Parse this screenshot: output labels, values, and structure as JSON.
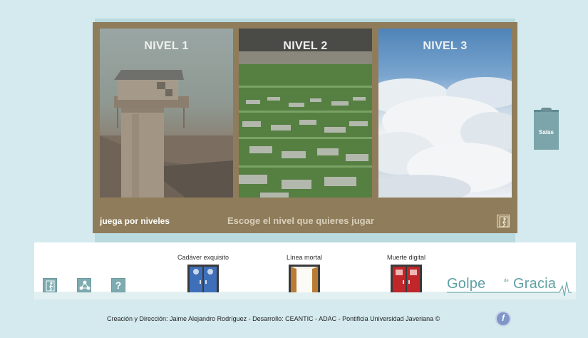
{
  "levels": [
    {
      "label": "NIVEL 1",
      "scene": "wooden-watchtower"
    },
    {
      "label": "NIVEL 2",
      "scene": "grassy-cemetery"
    },
    {
      "label": "NIVEL 3",
      "scene": "clouds-sky"
    }
  ],
  "frame": {
    "subtitle": "juega por niveles",
    "instruction": "Escoge el nivel que quieres jugar",
    "exit_icon": "exit-person-icon"
  },
  "side_tab": {
    "label": "Salas",
    "icon": "clipboard-clip-icon"
  },
  "toolbar": {
    "exit_icon": "exit-person-icon",
    "network_icon": "network-nodes-icon",
    "help_label": "?"
  },
  "doors": [
    {
      "title": "Cadáver exquisito",
      "state": "closed",
      "color": "#3f6fb8"
    },
    {
      "title": "Línea mortal",
      "state": "open",
      "color": "#e8e6e0"
    },
    {
      "title": "Muerte digital",
      "state": "closed",
      "color": "#c0262a"
    }
  ],
  "logo": {
    "word1": "Golpe",
    "de": "de",
    "word2": "Gracia"
  },
  "credits": "Creación y Dirección: Jaime Alejandro Rodríguez - Desarrollo: CEANTIC - ADAC - Pontificia Universidad Javeriana ©",
  "flash_icon": "flash-player-icon",
  "colors": {
    "frame": "#8f7c5a",
    "background": "#d4eaee",
    "accent": "#7eabb0",
    "logo": "#5fa0a4"
  }
}
